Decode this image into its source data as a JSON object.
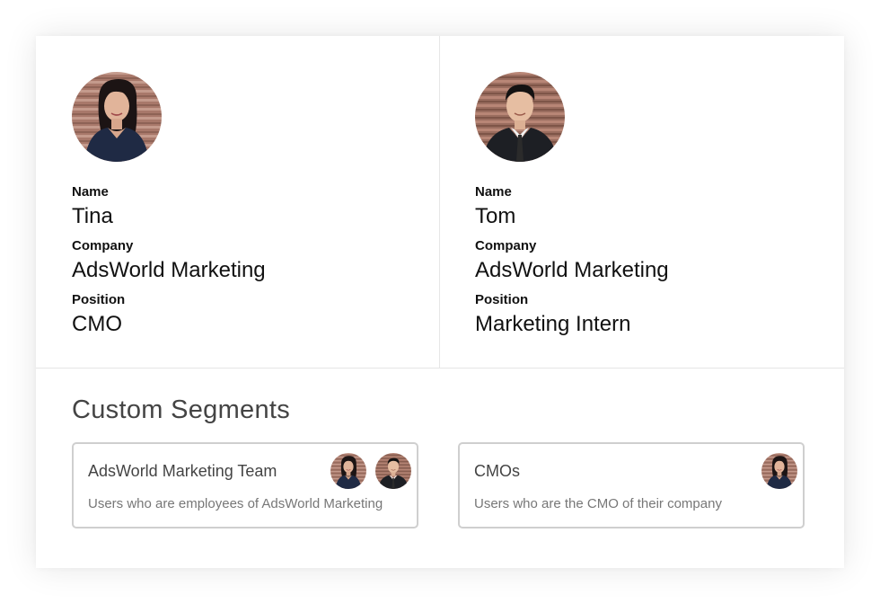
{
  "profiles": [
    {
      "avatar_icon": "woman-portrait-avatar",
      "name_label": "Name",
      "name_value": "Tina",
      "company_label": "Company",
      "company_value": "AdsWorld Marketing",
      "position_label": "Position",
      "position_value": "CMO"
    },
    {
      "avatar_icon": "man-portrait-avatar",
      "name_label": "Name",
      "name_value": "Tom",
      "company_label": "Company",
      "company_value": "AdsWorld Marketing",
      "position_label": "Position",
      "position_value": "Marketing Intern"
    }
  ],
  "segments": {
    "title": "Custom Segments",
    "items": [
      {
        "name": "AdsWorld Marketing Team",
        "description": "Users who are employees of AdsWorld Marketing",
        "members": [
          "Tina",
          "Tom"
        ]
      },
      {
        "name": "CMOs",
        "description": "Users who are the CMO of their company",
        "members": [
          "Tina"
        ]
      }
    ]
  },
  "colors": {
    "border": "#cfcfcf",
    "divider": "#e6e6e6",
    "heading": "#444444",
    "muted": "#777777"
  }
}
